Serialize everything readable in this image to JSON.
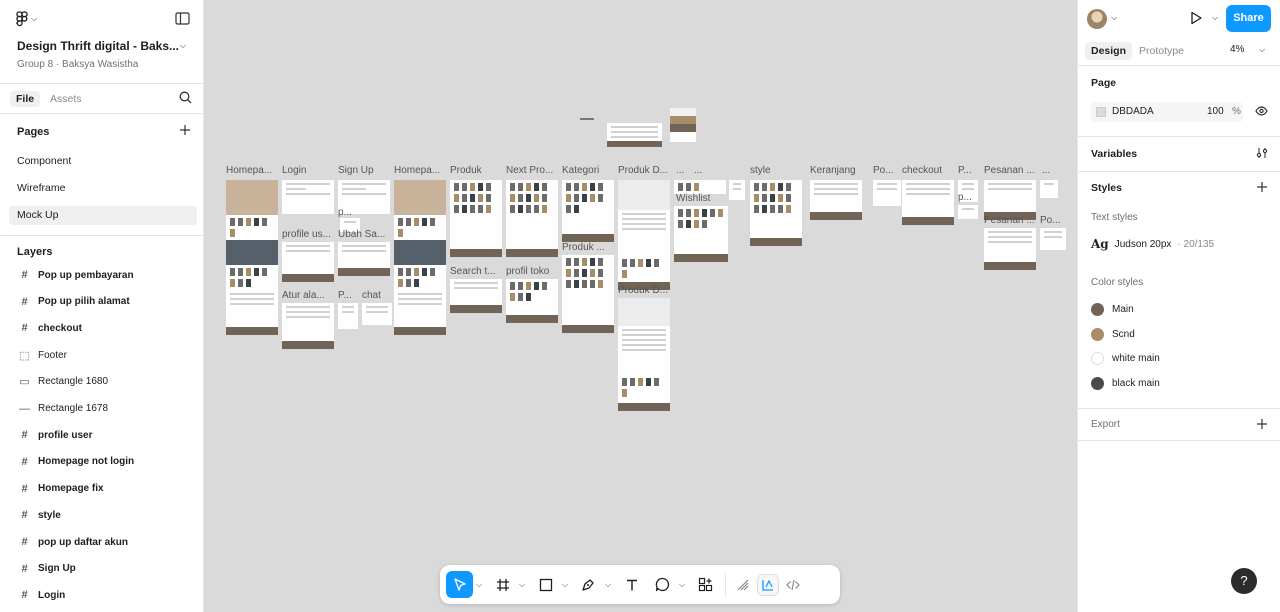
{
  "file": {
    "title": "Design Thrift digital - Baks...",
    "subtitle": "Group 8 · Baksya Wasistha"
  },
  "left_tabs": {
    "file": "File",
    "assets": "Assets"
  },
  "pages": {
    "heading": "Pages",
    "items": [
      {
        "label": "Component",
        "selected": false
      },
      {
        "label": "Wireframe",
        "selected": false
      },
      {
        "label": "Mock Up",
        "selected": true
      }
    ]
  },
  "layers": {
    "heading": "Layers",
    "items": [
      {
        "label": "Pop up pembayaran",
        "icon": "frame-icon",
        "bold": true
      },
      {
        "label": "Pop up pilih alamat",
        "icon": "frame-icon",
        "bold": true
      },
      {
        "label": "checkout",
        "icon": "frame-icon",
        "bold": true
      },
      {
        "label": "Footer",
        "icon": "dashed-frame-icon",
        "bold": false
      },
      {
        "label": "Rectangle 1680",
        "icon": "rectangle-icon",
        "bold": false
      },
      {
        "label": "Rectangle 1678",
        "icon": "line-icon",
        "bold": false
      },
      {
        "label": "profile user",
        "icon": "frame-icon",
        "bold": true
      },
      {
        "label": "Homepage not login",
        "icon": "frame-icon",
        "bold": true
      },
      {
        "label": "Homepage fix",
        "icon": "frame-icon",
        "bold": true
      },
      {
        "label": "style",
        "icon": "frame-icon",
        "bold": true
      },
      {
        "label": "pop up daftar akun",
        "icon": "frame-icon",
        "bold": true
      },
      {
        "label": "Sign Up",
        "icon": "frame-icon",
        "bold": true
      },
      {
        "label": "Login",
        "icon": "frame-icon",
        "bold": true
      }
    ]
  },
  "canvas": {
    "background": "#DBDADA",
    "frame_labels": [
      "Homepa...",
      "Login",
      "Sign Up",
      "Homepa...",
      "Produk",
      "Next Pro...",
      "Kategori",
      "Produk D...",
      "...",
      "...",
      "style",
      "Keranjang",
      "Po...",
      "checkout",
      "P...",
      "Pesanan ...",
      "...",
      "profile us...",
      "Ubah Sa...",
      "p...",
      "Atur ala...",
      "P...",
      "chat",
      "Search t...",
      "profil toko",
      "Produk ...",
      "Produk D...",
      "Wishlist",
      "p...",
      "Pesanan ...",
      "Po..."
    ]
  },
  "toolbar": {
    "tools": [
      "move-tool",
      "frame-tool",
      "rectangle-tool",
      "pen-tool",
      "text-tool",
      "comment-tool",
      "actions-tool"
    ],
    "selected": "move-tool",
    "modes": [
      "draw-mode",
      "design-mode",
      "dev-mode"
    ],
    "active_mode": "design-mode"
  },
  "right": {
    "share_label": "Share",
    "tabs": {
      "design": "Design",
      "prototype": "Prototype"
    },
    "zoom": "4%",
    "page_section": {
      "heading": "Page",
      "background_hex": "DBDADA",
      "opacity": "100",
      "percent": "%"
    },
    "variables_heading": "Variables",
    "styles_heading": "Styles",
    "text_styles_heading": "Text styles",
    "text_style": {
      "glyph": "Ag",
      "name": "Judson 20px",
      "meta": "· 20/135"
    },
    "color_styles_heading": "Color styles",
    "color_styles": [
      {
        "name": "Main",
        "color": "#716456"
      },
      {
        "name": "Scnd",
        "color": "#A88E68"
      },
      {
        "name": "white main",
        "color": "#FFFFFF"
      },
      {
        "name": "black main",
        "color": "#4A4A4A"
      }
    ],
    "export_heading": "Export",
    "help": "?"
  }
}
